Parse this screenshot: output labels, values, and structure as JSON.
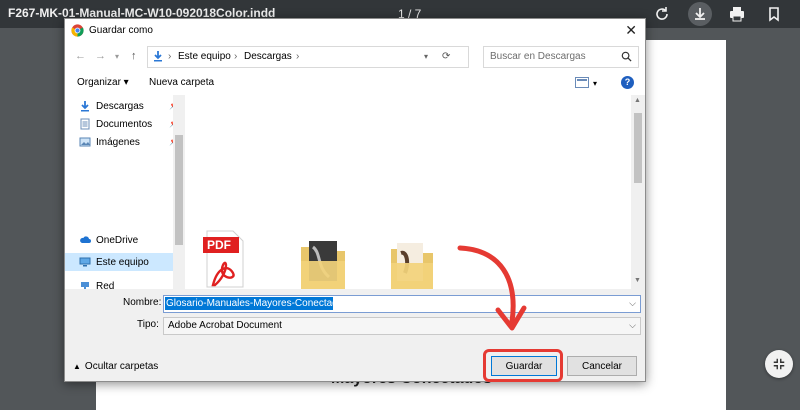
{
  "viewer": {
    "title": "F267-MK-01-Manual-MC-W10-092018Color.indd",
    "page_indicator": "1 / 7",
    "icons": [
      "rotate-icon",
      "download-icon",
      "print-icon",
      "bookmark-icon"
    ],
    "pdf_heading": "Mayores Conectados"
  },
  "dialog": {
    "title": "Guardar como",
    "close_label": "✕",
    "address": {
      "crumbs": [
        "Este equipo",
        "Descargas"
      ]
    },
    "search": {
      "placeholder": "Buscar en Descargas"
    },
    "commands": {
      "organize": "Organizar ▾",
      "new_folder": "Nueva carpeta"
    },
    "nav": {
      "items": [
        {
          "label": "Descargas",
          "icon": "download-arrow-icon",
          "pinned": true
        },
        {
          "label": "Documentos",
          "icon": "documents-icon",
          "pinned": true
        },
        {
          "label": "Imágenes",
          "icon": "images-icon",
          "pinned": true
        },
        {
          "label": "OneDrive",
          "icon": "cloud-icon",
          "pinned": false
        },
        {
          "label": "Este equipo",
          "icon": "computer-icon",
          "pinned": false,
          "selected": true
        },
        {
          "label": "Red",
          "icon": "network-icon",
          "pinned": false
        }
      ]
    },
    "form": {
      "name_label": "Nombre:",
      "name_value": "Glosario-Manuales-Mayores-Conectados",
      "type_label": "Tipo:",
      "type_value": "Adobe Acrobat Document"
    },
    "footer": {
      "hide_folders": "Ocultar carpetas",
      "save": "Guardar",
      "cancel": "Cancelar"
    },
    "files": [
      {
        "kind": "pdf",
        "icon_text": "PDF"
      },
      {
        "kind": "folder"
      },
      {
        "kind": "folder"
      }
    ]
  },
  "colors": {
    "accent": "#0078d7",
    "highlight": "#e53a33",
    "viewer_bar": "#323639"
  }
}
